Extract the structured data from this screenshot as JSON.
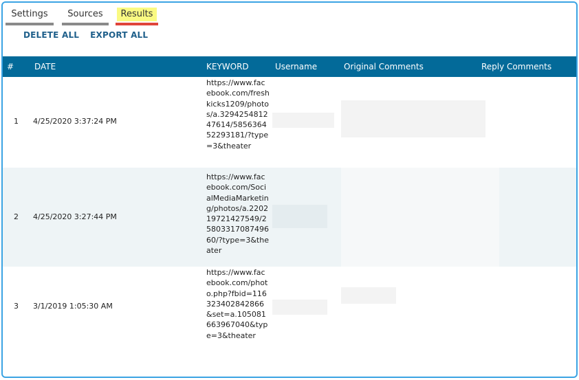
{
  "tabs": [
    {
      "label": "Settings"
    },
    {
      "label": "Sources"
    },
    {
      "label": "Results"
    }
  ],
  "actions": {
    "delete_all": "DELETE ALL",
    "export_all": "EXPORT ALL"
  },
  "table": {
    "columns": {
      "num": "#",
      "date": "DATE",
      "keyword": "KEYWORD",
      "username": "Username",
      "original": "Original Comments",
      "reply": "Reply Comments"
    },
    "rows": [
      {
        "num": "1",
        "date": "4/25/2020 3:37:24 PM",
        "keyword": "https://www.facebook.com/freshkicks1209/photos/a.329425481247614/585636452293181/?type=3&theater"
      },
      {
        "num": "2",
        "date": "4/25/2020 3:27:44 PM",
        "keyword": "https://www.facebook.com/SocialMediaMarketing/photos/a.220219721427549/2580331708749660/?type=3&theater"
      },
      {
        "num": "3",
        "date": "3/1/2019 1:05:30 AM",
        "keyword": "https://www.facebook.com/photo.php?fbid=116323402842866&set=a.105081663967040&type=3&theater"
      }
    ]
  },
  "colors": {
    "header_bg": "#036a99",
    "frame_border": "#3aa3e3",
    "active_tab_underline": "#e0453a",
    "active_tab_highlight": "#fafa82",
    "link": "#1e5f8a",
    "row_alt": "#eef4f6"
  }
}
